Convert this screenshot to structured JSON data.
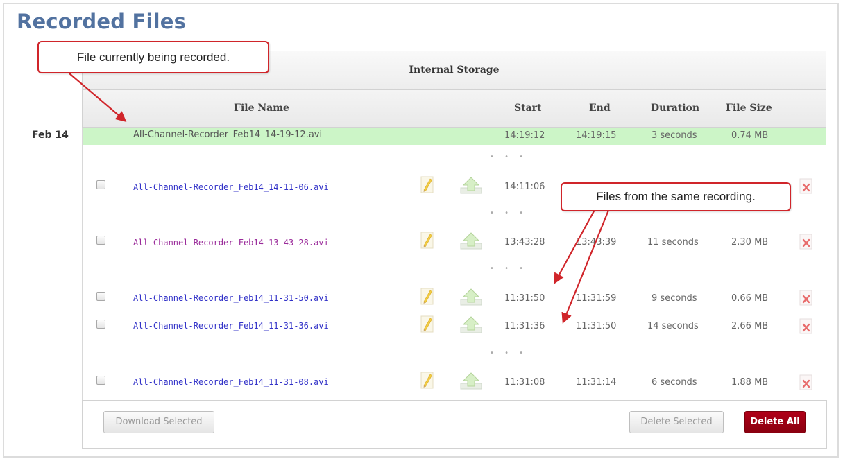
{
  "page": {
    "title": "Recorded Files"
  },
  "storage": {
    "title": "Internal Storage"
  },
  "columns": {
    "file_name": "File Name",
    "start": "Start",
    "end": "End",
    "duration": "Duration",
    "file_size": "File Size"
  },
  "date_group": "Feb 14",
  "current_file": {
    "name": "All-Channel-Recorder_Feb14_14-19-12.avi",
    "start": "14:19:12",
    "end": "14:19:15",
    "duration": "3 seconds",
    "size": "0.74 MB"
  },
  "files": [
    {
      "name": "All-Channel-Recorder_Feb14_14-11-06.avi",
      "start": "14:11:06",
      "end": "",
      "duration": "",
      "size": ""
    },
    {
      "name": "All-Channel-Recorder_Feb14_13-43-28.avi",
      "start": "13:43:28",
      "end": "13:43:39",
      "duration": "11 seconds",
      "size": "2.30 MB"
    },
    {
      "name": "All-Channel-Recorder_Feb14_11-31-50.avi",
      "start": "11:31:50",
      "end": "11:31:59",
      "duration": "9 seconds",
      "size": "0.66 MB"
    },
    {
      "name": "All-Channel-Recorder_Feb14_11-31-36.avi",
      "start": "11:31:36",
      "end": "11:31:50",
      "duration": "14 seconds",
      "size": "2.66 MB"
    },
    {
      "name": "All-Channel-Recorder_Feb14_11-31-08.avi",
      "start": "11:31:08",
      "end": "11:31:14",
      "duration": "6 seconds",
      "size": "1.88 MB"
    }
  ],
  "separator": "• • •",
  "buttons": {
    "download_selected": "Download Selected",
    "delete_selected": "Delete Selected",
    "delete_all": "Delete All"
  },
  "callouts": {
    "current": "File currently being recorded.",
    "same": "Files from the same recording."
  },
  "icons": {
    "rename": "pencil-icon",
    "upload": "upload-arrow-icon",
    "delete": "delete-x-icon"
  },
  "colors": {
    "title": "#5272a0",
    "current_row": "#ccf5c7",
    "link": "#3232c8",
    "visited_link": "#9a2b9a",
    "callout_border": "#d0252a",
    "delete_all": "#a00014"
  }
}
